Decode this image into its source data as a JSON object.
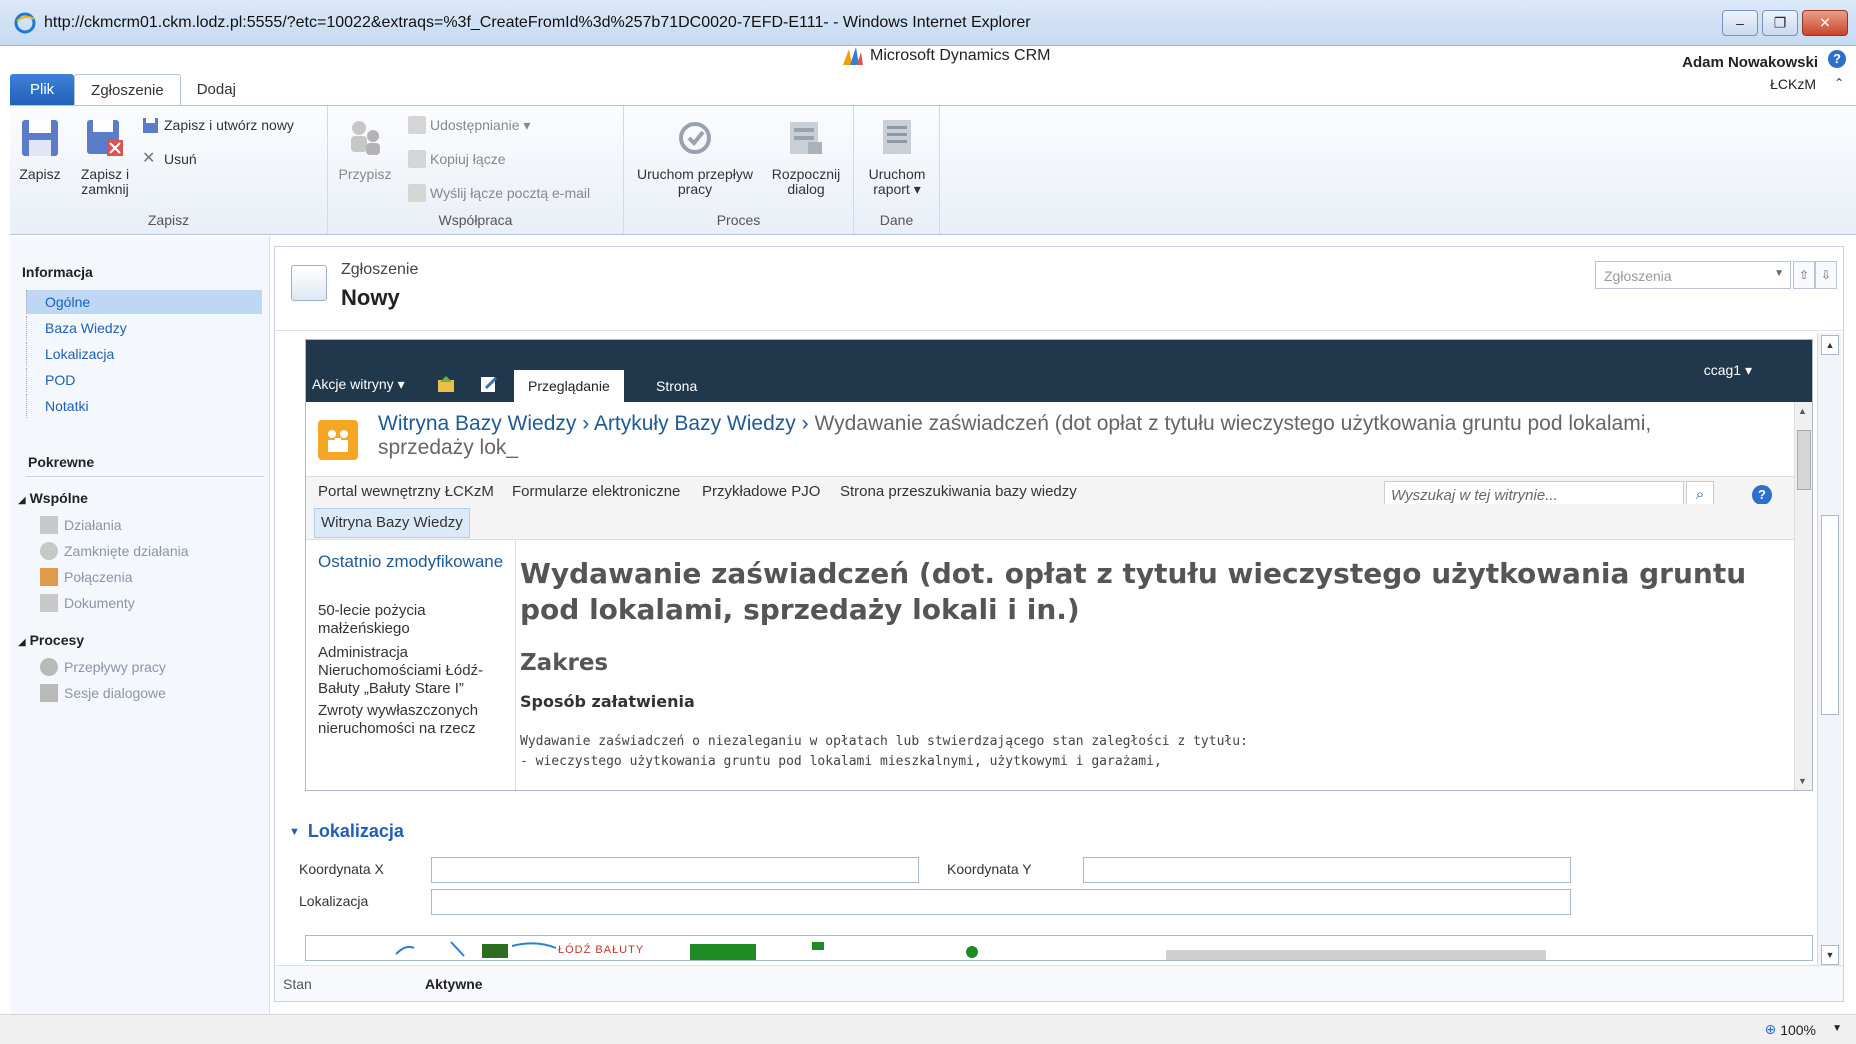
{
  "window": {
    "title": "http://ckmcrm01.ckm.lodz.pl:5555/?etc=10022&extraqs=%3f_CreateFromId%3d%257b71DC0020-7EFD-E111- - Windows Internet Explorer",
    "min": "–",
    "max": "❐",
    "close": "✕"
  },
  "header": {
    "brand": "Microsoft Dynamics CRM",
    "user": "Adam Nowakowski",
    "org": "ŁCKzM",
    "help": "?",
    "org_chevron": "⌃"
  },
  "tabs": {
    "file": "Plik",
    "active": "Zgłoszenie",
    "add": "Dodaj"
  },
  "ribbon": {
    "save": "Zapisz",
    "save_close": "Zapisz i zamknij",
    "save_new": "Zapisz i utwórz nowy",
    "delete": "Usuń",
    "group_save": "Zapisz",
    "assign": "Przypisz",
    "share": "Udostępnianie ▾",
    "copy_link": "Kopiuj łącze",
    "email_link": "Wyślij łącze pocztą e-mail",
    "group_collab": "Współpraca",
    "run_workflow": "Uruchom przepływ pracy",
    "start_dialog": "Rozpocznij dialog",
    "group_process": "Proces",
    "run_report": "Uruchom raport ▾",
    "group_data": "Dane"
  },
  "leftnav": {
    "info_title": "Informacja",
    "items": [
      "Ogólne",
      "Baza Wiedzy",
      "Lokalizacja",
      "POD",
      "Notatki"
    ],
    "related_title": "Pokrewne",
    "common_group": "Wspólne",
    "common_items": [
      "Działania",
      "Zamknięte działania",
      "Połączenia",
      "Dokumenty"
    ],
    "processes_group": "Procesy",
    "process_items": [
      "Przepływy pracy",
      "Sesje dialogowe"
    ]
  },
  "form": {
    "entity_type": "Zgłoszenie",
    "entity_name": "Nowy",
    "view_select": "Zgłoszenia",
    "up": "⇧",
    "down": "⇩"
  },
  "sharepoint": {
    "site_actions": "Akcje witryny ▾",
    "tab_browse": "Przeglądanie",
    "tab_page": "Strona",
    "user": "ccag1 ▾",
    "crumb_1": "Witryna Bazy Wiedzy",
    "crumb_sep": " › ",
    "crumb_2": "Artykuły Bazy Wiedzy",
    "crumb_sep2": " › ",
    "crumb_3": "Wydawanie zaświadczeń (dot opłat z tytułu wieczystego użytkowania gruntu pod lokalami, sprzedaży lok_",
    "nav": [
      "Portal wewnętrzny ŁCKzM",
      "Formularze elektroniczne",
      "Przykładowe PJO",
      "Strona przeszukiwania bazy wiedzy"
    ],
    "search_placeholder": "Wyszukaj w tej witrynie...",
    "sub_nav": "Witryna Bazy Wiedzy",
    "left_heading": "Ostatnio zmodyfikowane",
    "left_items": [
      "50-lecie pożycia małżeńskiego",
      "Administracja Nieruchomościami Łódź-Bałuty „Bałuty Stare I”",
      "Zwroty wywłaszczonych nieruchomości na rzecz"
    ],
    "h1": "Wydawanie zaświadczeń (dot. opłat z tytułu wieczystego użytkowania gruntu pod lokalami, sprzedaży lokali i in.)",
    "h2": "Zakres",
    "h3": "Sposób załatwienia",
    "body_1": "Wydawanie zaświadczeń o niezaleganiu w opłatach lub stwierdzającego stan zaległości z tytułu:",
    "body_2": "- wieczystego użytkowania gruntu pod lokalami mieszkalnymi, użytkowymi i garażami,"
  },
  "location": {
    "section_title": "Lokalizacja",
    "coord_x": "Koordynata X",
    "coord_y": "Koordynata Y",
    "location_label": "Lokalizacja",
    "coord_x_value": "",
    "coord_y_value": "",
    "location_value": "",
    "map_text": "ŁÓDŹ BAŁUTY"
  },
  "footer": {
    "status_label": "Stan",
    "status_value": "Aktywne"
  },
  "statusbar": {
    "zoom": "100%"
  }
}
